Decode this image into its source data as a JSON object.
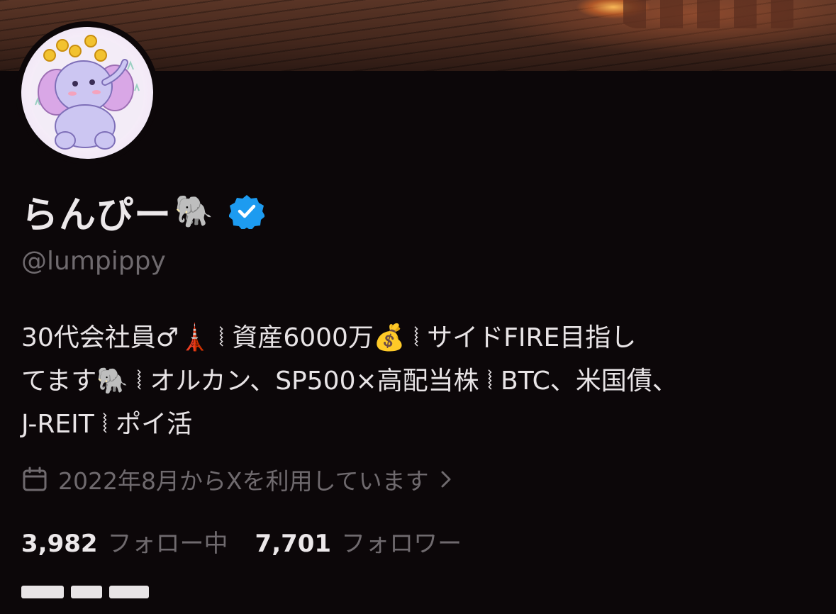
{
  "profile": {
    "display_name": "らんぴー",
    "name_emoji": "🐘",
    "handle": "@lumpippy",
    "verified_icon": "verified-badge-icon",
    "avatar_icon": "elephant-avatar",
    "bio_lines": [
      "30代会社員♂🗼 ⦚ 資産6000万💰 ⦚ サイドFIRE目指し",
      "てます🐘 ⦚ オルカン、SP500×高配当株 ⦚ BTC、米国債、",
      "J-REIT ⦚ ポイ活"
    ],
    "joined_text": "2022年8月からXを利用しています",
    "following": {
      "count": "3,982",
      "label": "フォロー中"
    },
    "followers": {
      "count": "7,701",
      "label": "フォロワー"
    }
  },
  "colors": {
    "background": "#0c0709",
    "verified_blue": "#1d9bf0",
    "muted_text": "#6f6a6e",
    "primary_text": "#e7e2e4"
  }
}
